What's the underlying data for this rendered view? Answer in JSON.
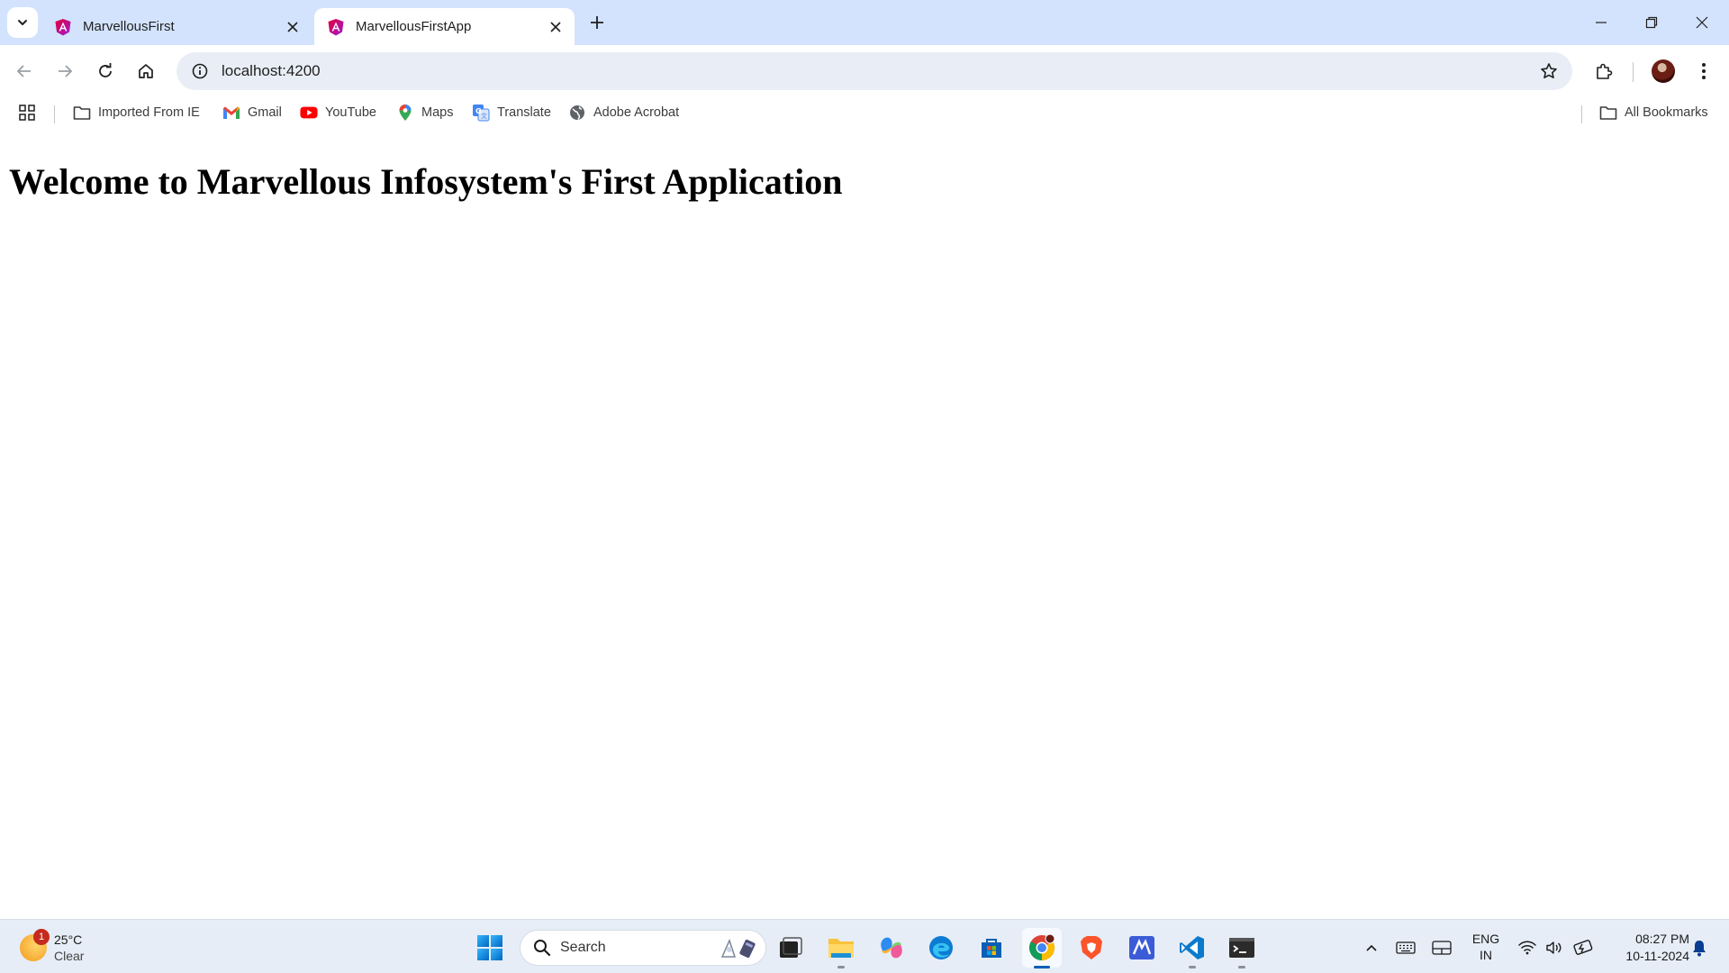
{
  "browser": {
    "tabs": [
      {
        "title": "MarvellousFirst",
        "active": false
      },
      {
        "title": "MarvellousFirstApp",
        "active": true
      }
    ],
    "address": "localhost:4200"
  },
  "bookmarks": {
    "items": [
      {
        "label": "Imported From IE",
        "icon": "folder-icon"
      },
      {
        "label": "Gmail",
        "icon": "gmail-icon"
      },
      {
        "label": "YouTube",
        "icon": "youtube-icon"
      },
      {
        "label": "Maps",
        "icon": "maps-icon"
      },
      {
        "label": "Translate",
        "icon": "translate-icon"
      },
      {
        "label": "Adobe Acrobat",
        "icon": "globe-icon"
      }
    ],
    "all_bookmarks": "All Bookmarks"
  },
  "page": {
    "heading": "Welcome to Marvellous Infosystem's First Application"
  },
  "taskbar": {
    "weather": {
      "temp": "25°C",
      "condition": "Clear",
      "badge": "1"
    },
    "search_placeholder": "Search",
    "language": {
      "line1": "ENG",
      "line2": "IN"
    },
    "clock": {
      "time": "08:27 PM",
      "date": "10-11-2024"
    }
  },
  "colors": {
    "tabstrip": "#d3e3fd",
    "omnibox": "#e9eef6",
    "taskbar": "#e6edf7",
    "angular_red": "#dd0031"
  }
}
